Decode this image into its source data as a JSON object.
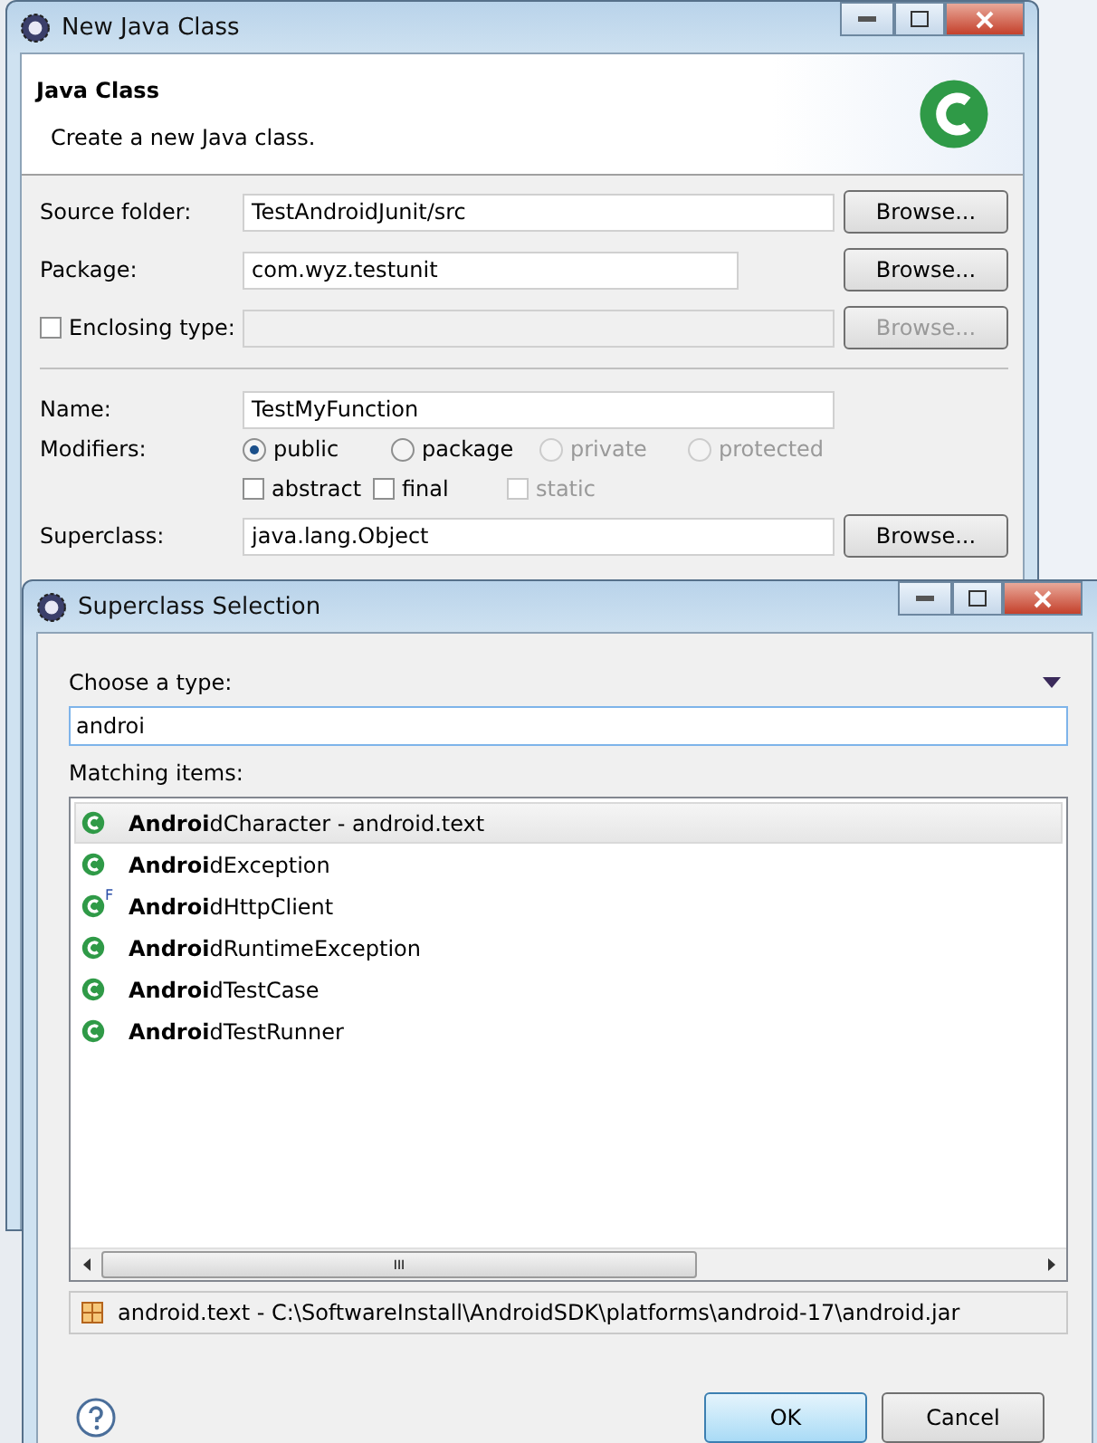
{
  "back_window": {
    "title": "New Java Class",
    "header": {
      "title": "Java Class",
      "description": "Create a new Java class."
    },
    "fields": [
      {
        "kind": "text",
        "label": "Source folder:",
        "value": "TestAndroidJunit/src",
        "button": "Browse...",
        "disabled": false,
        "short": false
      },
      {
        "kind": "text",
        "label": "Package:",
        "value": "com.wyz.testunit",
        "button": "Browse...",
        "disabled": false,
        "short": true
      },
      {
        "kind": "check",
        "label": "Enclosing type:",
        "checked": false,
        "button": "Browse...",
        "disabled": true,
        "short": false
      }
    ],
    "name": {
      "label": "Name:",
      "value": "TestMyFunction"
    },
    "modifiers": {
      "label": "Modifiers:",
      "radios": [
        {
          "label": "public",
          "selected": true,
          "disabled": false
        },
        {
          "label": "package",
          "selected": false,
          "disabled": false
        },
        {
          "label": "private",
          "selected": false,
          "disabled": true
        },
        {
          "label": "protected",
          "selected": false,
          "disabled": true
        }
      ],
      "checks": [
        {
          "label": "abstract",
          "checked": false,
          "disabled": false
        },
        {
          "label": "final",
          "checked": false,
          "disabled": false
        },
        {
          "label": "static",
          "checked": false,
          "disabled": true
        }
      ]
    },
    "superclass": {
      "label": "Superclass:",
      "value": "java.lang.Object",
      "button": "Browse..."
    }
  },
  "dialog": {
    "title": "Superclass Selection",
    "prompt": "Choose a type:",
    "search": {
      "value": "androi"
    },
    "list_label": "Matching items:",
    "items": [
      {
        "text": "**Androi**dCharacter - android.text",
        "selected": true
      },
      {
        "text": "**Androi**dException",
        "selected": false
      },
      {
        "text": "**Androi**dHttpClient",
        "selected": false,
        "badge": "F"
      },
      {
        "text": "**Androi**dRuntimeException",
        "selected": false
      },
      {
        "text": "**Androi**dTestCase",
        "selected": false
      },
      {
        "text": "**Androi**dTestRunner",
        "selected": false
      }
    ],
    "scroll_grip": "III",
    "status": "android.text - C:\\SoftwareInstall\\AndroidSDK\\platforms\\android-17\\android.jar",
    "buttons": [
      {
        "label": "OK",
        "default": true
      },
      {
        "label": "Cancel",
        "default": false
      }
    ]
  }
}
